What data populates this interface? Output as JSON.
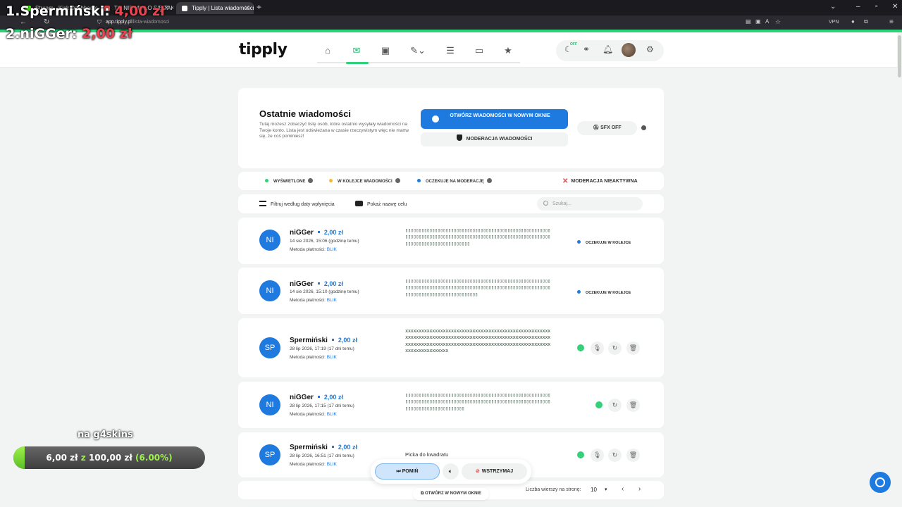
{
  "browser": {
    "tabs": [
      {
        "title": "Stream - Kick Dashboard",
        "color": "#53fc18"
      },
      {
        "title": "TO NIE MIAŁO SIĘ TAK SKOŃCZYĆ",
        "color": "#e5484d"
      },
      {
        "title": "Tipply | Lista wiadomości",
        "color": "#ffffff"
      }
    ],
    "new_tab": "+",
    "address_domain": "app.tipply.pl",
    "address_path": "/lista-wiadomosci",
    "vpn_label": "VPN"
  },
  "overlay": {
    "top1_rank_name": "1.Spermiński:",
    "top1_amount": "4,00 zł",
    "top2_rank_name": "2.niGGer:",
    "top2_amount": "2,00 zł",
    "goal_title": "na g4skins",
    "goal_current": "6,00 zł",
    "goal_sep": "z",
    "goal_target": "100,00 zł",
    "goal_percent": "(6.00%)",
    "goal_fraction": 0.06
  },
  "header": {
    "logo": "tipply",
    "off_badge": "OFF"
  },
  "top": {
    "title": "Ostatnie wiadomości",
    "description": "Tutaj możesz zobaczyć listę osób, które ostatnio wysyłały wiadomości na Twoje konto. Lista jest odświeżana w czasie rzeczywistym więc nie martw się, że coś pominiesz!",
    "open_button": "OTWÓRZ WIADOMOŚCI W NOWYM OKNIE",
    "moderation_button": "MODERACJA WIADOMOŚCI",
    "sfx_button": "SFX OFF"
  },
  "legend": {
    "displayed": "WYŚWIETLONE",
    "queued": "W KOLEJCE WIADOMOŚCI",
    "awaiting": "OCZEKUJE NA MODERACJĘ",
    "moderation_inactive": "MODERACJA NIEAKTYWNA",
    "colors": {
      "displayed": "#34d17a",
      "queued": "#f5b82e",
      "awaiting": "#1f7ae0"
    }
  },
  "filters": {
    "date_filter": "Filtruj według daty wpłynięcia",
    "show_goal": "Pokaż nazwę celu",
    "search_placeholder": "Szukaj..."
  },
  "messages": [
    {
      "initials": "NI",
      "name": "niGGer",
      "amount": "2,00 zł",
      "date": "14 sie 2026, 15:06 (godzinę temu)",
      "method_label": "Metoda płatności:",
      "method": "BLIK",
      "text": "▯▯▯▯▯▯▯▯▯▯▯▯▯▯▯▯▯▯▯▯▯▯▯▯▯▯▯▯▯▯▯▯▯▯▯▯▯▯▯▯▯▯▯▯▯▯▯▯▯▯▯▯▯▯▯▯▯▯▯▯▯▯▯▯▯▯▯▯▯▯▯▯▯▯▯▯▯▯▯▯▯▯▯▯▯▯▯▯▯▯▯▯▯▯▯▯▯▯▯▯▯▯▯▯▯▯▯▯▯▯▯▯▯▯▯▯▯▯▯▯▯▯▯▯▯▯▯▯▯▯▯▯",
      "status": "OCZEKUJE W KOLEJCE"
    },
    {
      "initials": "NI",
      "name": "niGGer",
      "amount": "2,00 zł",
      "date": "14 sie 2026, 15:10 (godzinę temu)",
      "method_label": "Metoda płatności:",
      "method": "BLIK",
      "text": "▯▯▯▯▯▯▯▯▯▯▯▯▯▯▯▯▯▯▯▯▯▯▯▯▯▯▯▯▯▯▯▯▯▯▯▯▯▯▯▯▯▯▯▯▯▯▯▯▯▯▯▯▯▯▯▯▯▯▯▯▯▯▯▯▯▯▯▯▯▯▯▯▯▯▯▯▯▯▯▯▯▯▯▯▯▯▯▯▯▯▯▯▯▯▯▯▯▯▯▯▯▯▯▯▯▯▯▯▯▯▯▯▯▯▯▯▯▯▯▯▯▯▯▯▯▯▯▯▯▯▯▯▯▯▯",
      "status": "OCZEKUJE W KOLEJCE"
    },
    {
      "initials": "SP",
      "name": "Spermiński",
      "amount": "2,00 zł",
      "date": "28 lip 2026, 17:19 (17 dni temu)",
      "method_label": "Metoda płatności:",
      "method": "BLIK",
      "text": "xxxxxxxxxxxxxxxxxxxxxxxxxxxxxxxxxxxxxxxxxxxxxxxxxxxxxxxxxxxxxxxxxxxxxxxxxxxxxxxxxxxxxxxxxxxxxxxxxxxxxxxxxxxxxxxxxxxxxxxxxxxxxxxxxxxxxxxxxxxxxxxxxxxxxxxxxxxxxxxxxxxxxxxxxxxxxxxxxx",
      "status": ""
    },
    {
      "initials": "NI",
      "name": "niGGer",
      "amount": "2,00 zł",
      "date": "28 lip 2026, 17:15 (17 dni temu)",
      "method_label": "Metoda płatności:",
      "method": "BLIK",
      "text": "▯▯▯▯▯▯▯▯▯▯▯▯▯▯▯▯▯▯▯▯▯▯▯▯▯▯▯▯▯▯▯▯▯▯▯▯▯▯▯▯▯▯▯▯▯▯▯▯▯▯▯▯▯▯▯▯▯▯▯▯▯▯▯▯▯▯▯▯▯▯▯▯▯▯▯▯▯▯▯▯▯▯▯▯▯▯▯▯▯▯▯▯▯▯▯▯▯▯▯▯▯▯▯▯▯▯▯▯▯▯▯▯▯▯▯▯▯▯▯▯▯▯▯▯▯▯▯▯▯▯",
      "status": ""
    },
    {
      "initials": "SP",
      "name": "Spermiński",
      "amount": "2,00 zł",
      "date": "28 lip 2026, 16:51 (17 dni temu)",
      "method_label": "Metoda płatności:",
      "method": "BLIK",
      "text": "Picka do kwadratu",
      "status": ""
    }
  ],
  "player": {
    "skip": "POMIŃ",
    "hold": "WSTRZYMAJ",
    "open_new": "OTWÓRZ W NOWYM OKNIE"
  },
  "pager": {
    "rows_label": "Liczba wierszy na stronę:",
    "rows_value": "10"
  }
}
